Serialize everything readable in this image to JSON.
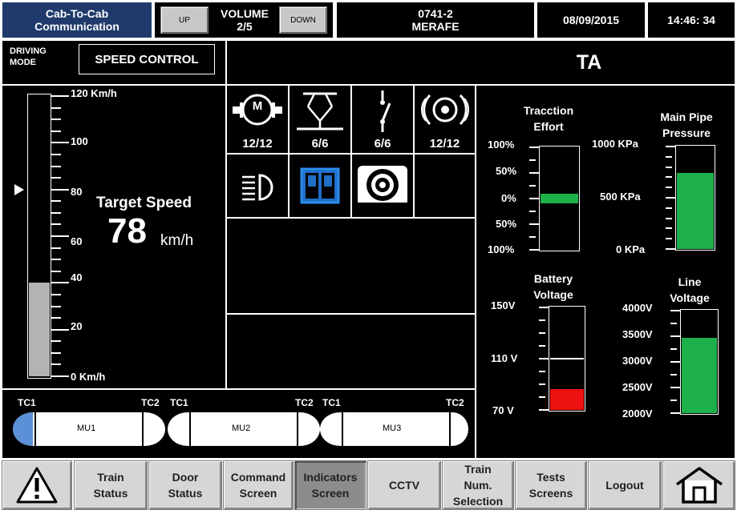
{
  "header": {
    "cab_title": "Cab-To-Cab\nCommunication",
    "volume_up": "UP",
    "volume_label": "VOLUME\n2/5",
    "volume_down": "DOWN",
    "train_info": "0741-2\nMERAFE",
    "date": "08/09/2015",
    "time": "14:46: 34"
  },
  "mode": {
    "driving_mode_label": "DRIVING\nMODE",
    "value": "SPEED CONTROL",
    "code": "TA"
  },
  "speed": {
    "scale_labels": [
      "120 Km/h",
      "100",
      "80",
      "60",
      "40",
      "20",
      "0 Km/h"
    ],
    "target_label": "Target Speed",
    "target_value": "78",
    "target_unit": "km/h",
    "current_speed_kmh": 40,
    "target_marker_kmh": 80,
    "max_kmh": 120
  },
  "indicators": {
    "motor_icon_label": "M",
    "motor_count": "12/12",
    "pantograph_count": "6/6",
    "breaker_count": "6/6",
    "brake_count": "12/12",
    "icons": [
      "motor-icon",
      "pantograph-icon",
      "circuit-breaker-icon",
      "brake-disc-icon",
      "headlight-icon",
      "door-icon",
      "wheel-brake-icon"
    ]
  },
  "gauges": {
    "traction": {
      "title": "Tracction\nEffort",
      "labels": [
        "100%",
        "50%",
        "0%",
        "50%",
        "100%"
      ],
      "value_percent": 0,
      "color": "#1db04b"
    },
    "main_pipe": {
      "title": "Main Pipe\nPressure",
      "labels": [
        "1000 KPa",
        "500 KPa",
        "0 KPa"
      ],
      "value_kpa": 740,
      "color": "#1db04b"
    },
    "battery": {
      "title": "Battery\nVoltage",
      "labels": [
        "150V",
        "110 V",
        "70 V"
      ],
      "value_v": 86,
      "color": "#ee1111"
    },
    "line": {
      "title": "Line\nVoltage",
      "labels": [
        "4000V",
        "3500V",
        "3000V",
        "2500V",
        "2000V"
      ],
      "value_v": 3470,
      "color": "#1db04b"
    }
  },
  "train": {
    "units": [
      {
        "name": "MU1",
        "left": "TC1",
        "right": "TC2"
      },
      {
        "name": "MU2",
        "left": "TC1",
        "right": "TC2"
      },
      {
        "name": "MU3",
        "left": "TC1",
        "right": "TC2"
      }
    ],
    "active_cab_color": "#5b8fd6"
  },
  "nav": {
    "train_status": "Train\nStatus",
    "door_status": "Door\nStatus",
    "command_screen": "Command\nScreen",
    "indicators_screen": "Indicators\nScreen",
    "cctv": "CCTV",
    "train_num_selection": "Train\nNum.\nSelection",
    "tests_screens": "Tests\nScreens",
    "logout": "Logout"
  }
}
